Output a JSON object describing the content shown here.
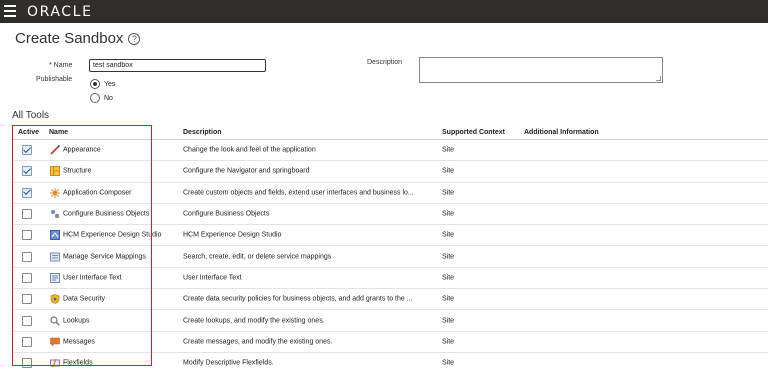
{
  "header": {
    "logo": "ORACLE"
  },
  "page": {
    "title": "Create Sandbox"
  },
  "form": {
    "name_label": "Name",
    "name_value": "test sandbox",
    "publishable_label": "Publishable",
    "options": [
      "Yes",
      "No"
    ],
    "selected": "Yes",
    "description_label": "Description",
    "description_value": ""
  },
  "tools": {
    "section_title": "All Tools",
    "columns": [
      "Active",
      "Name",
      "Description",
      "Supported Context",
      "Additional Information"
    ],
    "rows": [
      {
        "active": true,
        "icon": "paintbrush-icon",
        "name": "Appearance",
        "description": "Change the look and feel of the application",
        "context": "Site"
      },
      {
        "active": true,
        "icon": "structure-icon",
        "name": "Structure",
        "description": "Configure the Navigator and springboard",
        "context": "Site"
      },
      {
        "active": true,
        "icon": "composer-icon",
        "name": "Application Composer",
        "description": "Create custom objects and fields, extend user interfaces and business lo...",
        "context": "Site"
      },
      {
        "active": false,
        "icon": "business-objects-icon",
        "name": "Configure Business Objects",
        "description": "Configure Business Objects",
        "context": "Site"
      },
      {
        "active": false,
        "icon": "hcm-design-icon",
        "name": "HCM Experience Design Studio",
        "description": "HCM Experience Design Studio",
        "context": "Site"
      },
      {
        "active": false,
        "icon": "service-mappings-icon",
        "name": "Manage Service Mappings",
        "description": "Search, create, edit, or delete service mappings",
        "context": "Site"
      },
      {
        "active": false,
        "icon": "ui-text-icon",
        "name": "User Interface Text",
        "description": "User Interface Text",
        "context": "Site"
      },
      {
        "active": false,
        "icon": "data-security-icon",
        "name": "Data Security",
        "description": "Create data security policies for business objects, and add grants to the ...",
        "context": "Site"
      },
      {
        "active": false,
        "icon": "lookups-icon",
        "name": "Lookups",
        "description": "Create lookups, and modify the existing ones.",
        "context": "Site"
      },
      {
        "active": false,
        "icon": "messages-icon",
        "name": "Messages",
        "description": "Create messages, and modify the existing ones.",
        "context": "Site"
      },
      {
        "active": false,
        "icon": "flexfields-icon",
        "name": "Flexfields",
        "description": "Modify Descriptive Flexfields.",
        "context": "Site"
      }
    ]
  },
  "colors": {
    "topbar": "#312d2a",
    "highlight": "#d11f26",
    "checkbox_checked": "#1f4e8c"
  }
}
